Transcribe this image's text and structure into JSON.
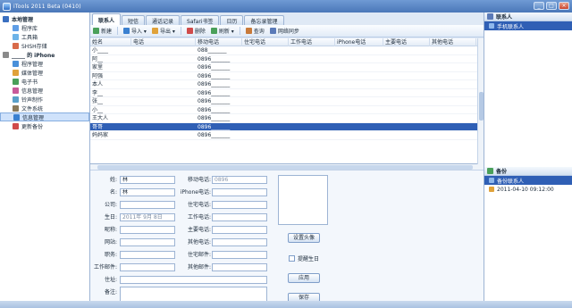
{
  "window": {
    "title": "iTools 2011 Beta (0410)",
    "minimize": "_",
    "maximize": "□",
    "close": "×"
  },
  "sidebar": {
    "items": [
      {
        "label": "本地管理",
        "level": 0,
        "color": "#3a6fc0"
      },
      {
        "label": "程序库",
        "level": 1,
        "color": "#5f9ee6"
      },
      {
        "label": "工具箱",
        "level": 1,
        "color": "#6db3e8"
      },
      {
        "label": "SHSH存储",
        "level": 1,
        "color": "#d86a4a"
      },
      {
        "label": "_____ 的 iPhone",
        "level": 0,
        "color": "#8a8a8a"
      },
      {
        "label": "程序管理",
        "level": 1,
        "color": "#4a90d9"
      },
      {
        "label": "媒体管理",
        "level": 1,
        "color": "#e0a23a"
      },
      {
        "label": "电子书",
        "level": 1,
        "color": "#4aa05a"
      },
      {
        "label": "信息管理",
        "level": 1,
        "color": "#c85a9a"
      },
      {
        "label": "铃声制作",
        "level": 1,
        "color": "#5aa0c8"
      },
      {
        "label": "文件系统",
        "level": 1,
        "color": "#8a7a5a"
      },
      {
        "label": "信息管理",
        "level": 1,
        "color": "#3a80d0",
        "selected": true
      },
      {
        "label": "更新备份",
        "level": 1,
        "color": "#d04a4a"
      }
    ]
  },
  "tabs": [
    {
      "label": "联系人",
      "active": true
    },
    {
      "label": "短信",
      "active": false
    },
    {
      "label": "通话记录",
      "active": false
    },
    {
      "label": "Safari书签",
      "active": false
    },
    {
      "label": "日历",
      "active": false
    },
    {
      "label": "备忘录管理",
      "active": false
    }
  ],
  "toolbar": {
    "new": "新建",
    "import": "导入 ▾",
    "export": "导出 ▾",
    "delete": "删除",
    "refresh": "刷新 ▾",
    "query": "查询",
    "sync": "网络同步"
  },
  "table": {
    "headers": [
      "姓名",
      "电话",
      "移动电话",
      "住宅电话",
      "工作电话",
      "iPhone电话",
      "主要电话",
      "其他电话"
    ],
    "rows": [
      {
        "name": "小____",
        "phone": "088_______",
        "selected": false
      },
      {
        "name": "阿__",
        "phone": "0896_______",
        "selected": false
      },
      {
        "name": "家里",
        "phone": "0896_______",
        "selected": false
      },
      {
        "name": "阿强",
        "phone": "0896_______",
        "selected": false
      },
      {
        "name": "本人",
        "phone": "0896_______",
        "selected": false
      },
      {
        "name": "李__",
        "phone": "0896_______",
        "selected": false
      },
      {
        "name": "张__",
        "phone": "0896_______",
        "selected": false
      },
      {
        "name": "小__",
        "phone": "0896_______",
        "selected": false
      },
      {
        "name": "王大人",
        "phone": "0896_______",
        "selected": false
      },
      {
        "name": "哥哥",
        "phone": "0896_______",
        "selected": true
      },
      {
        "name": "妈妈家",
        "phone": "0896_______",
        "selected": false
      }
    ]
  },
  "form": {
    "fields_left": [
      {
        "label": "姓:",
        "value": "林"
      },
      {
        "label": "名:",
        "value": "林"
      },
      {
        "label": "公司:",
        "value": ""
      },
      {
        "label": "生日:",
        "value": "2011年 9月 8日"
      },
      {
        "label": "昵称:",
        "value": ""
      },
      {
        "label": "网站:",
        "value": ""
      },
      {
        "label": "职务:",
        "value": ""
      },
      {
        "label": "工作邮件:",
        "value": ""
      },
      {
        "label": "住址:",
        "value": ""
      },
      {
        "label": "备注:",
        "value": ""
      }
    ],
    "fields_right": [
      {
        "label": "移动电话:",
        "value": "0896"
      },
      {
        "label": "iPhone电话:",
        "value": ""
      },
      {
        "label": "住宅电话:",
        "value": ""
      },
      {
        "label": "工作电话:",
        "value": ""
      },
      {
        "label": "主要电话:",
        "value": ""
      },
      {
        "label": "其他电话:",
        "value": ""
      },
      {
        "label": "住宅邮件:",
        "value": ""
      },
      {
        "label": "其他邮件:",
        "value": ""
      }
    ],
    "set_photo": "设置头像",
    "birthday_checkbox": "提醒生日",
    "apply": "应用",
    "save": "保存"
  },
  "right_panel": {
    "contacts_header": "联系人",
    "contacts_selected": "手机联系人",
    "groups_header": "备份",
    "group_items": [
      {
        "label": "备份联系人",
        "selected": true
      },
      {
        "label": "2011-04-10 09:12:00",
        "selected": false
      }
    ]
  }
}
